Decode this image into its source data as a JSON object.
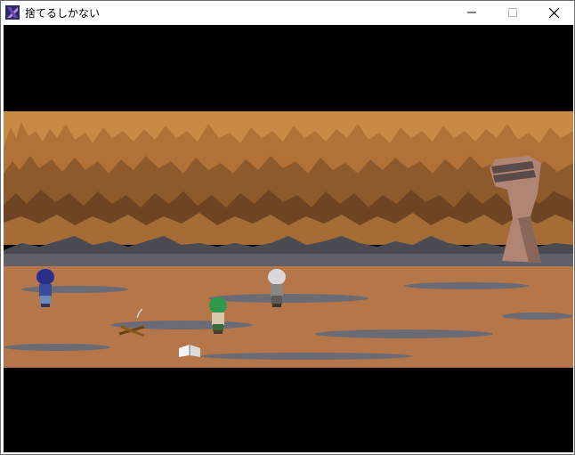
{
  "window": {
    "title": "捨てるしかない",
    "icon": "game-app-icon",
    "controls": {
      "minimize_icon": "minimize-icon",
      "maximize_icon": "maximize-icon",
      "close_icon": "close-icon"
    }
  },
  "scene": {
    "description_icon": "ruined-city-wasteland",
    "colors": {
      "sky": "#c88a44",
      "city_light": "#b7793c",
      "city_dark": "#6e4422",
      "ground": "#b5764a",
      "rubble": "#55565e",
      "letterbox": "#000000"
    },
    "characters": [
      {
        "name": "blue-haired-character",
        "icon": "character-sprite"
      },
      {
        "name": "green-haired-character",
        "icon": "character-sprite"
      },
      {
        "name": "white-haired-character",
        "icon": "character-sprite"
      }
    ],
    "objects": [
      {
        "name": "campfire",
        "icon": "campfire-icon"
      },
      {
        "name": "open-book",
        "icon": "book-icon"
      },
      {
        "name": "giant-stone-fist",
        "icon": "fist-statue-icon"
      }
    ]
  }
}
